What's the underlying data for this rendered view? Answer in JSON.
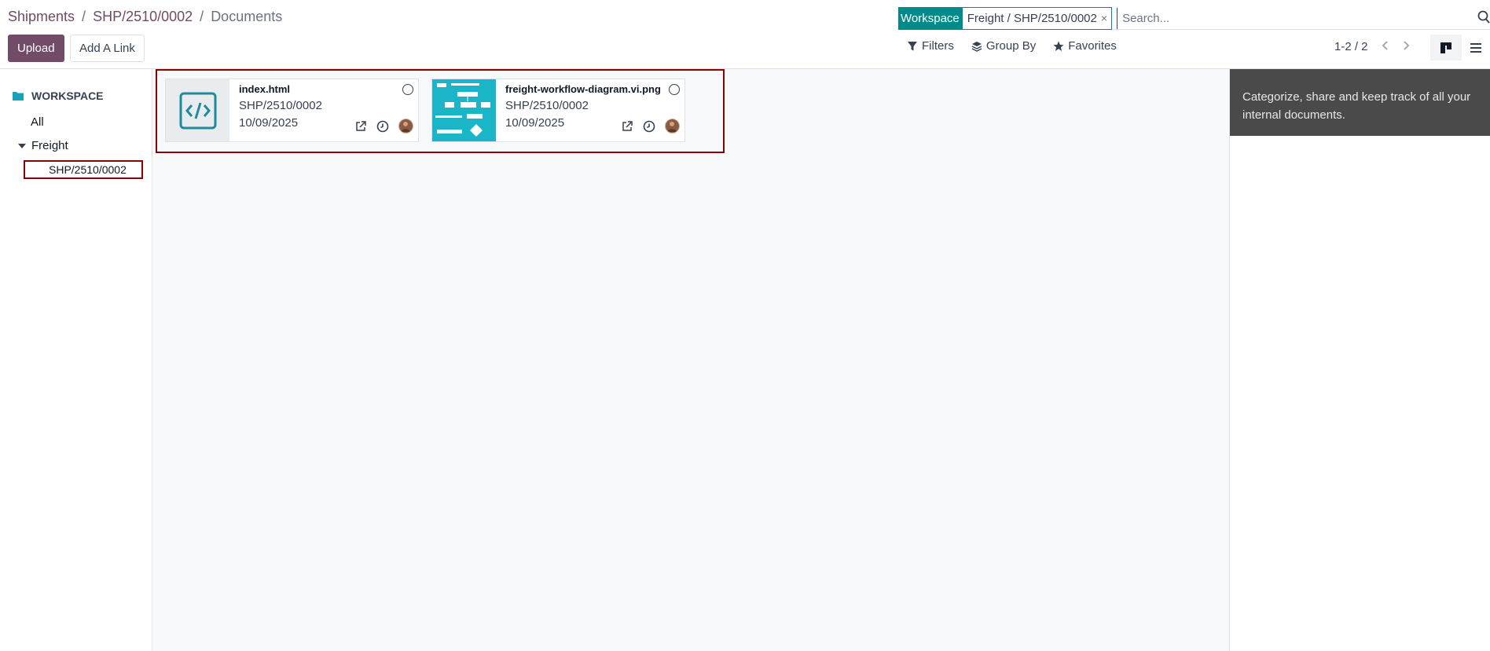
{
  "breadcrumb": {
    "items": [
      "Shipments",
      "SHP/2510/0002"
    ],
    "current": "Documents"
  },
  "toolbar": {
    "upload_label": "Upload",
    "add_link_label": "Add A Link"
  },
  "search": {
    "facet_label": "Workspace",
    "facet_value": "Freight / SHP/2510/0002",
    "facet_close": "×",
    "placeholder": "Search..."
  },
  "filters": {
    "filters_label": "Filters",
    "group_by_label": "Group By",
    "favorites_label": "Favorites"
  },
  "pager": {
    "value": "1-2 / 2"
  },
  "sidebar": {
    "workspace_title": "WORKSPACE",
    "all_label": "All",
    "freight_label": "Freight",
    "selected_label": "SHP/2510/0002"
  },
  "documents": [
    {
      "name": "index.html",
      "record": "SHP/2510/0002",
      "date": "10/09/2025",
      "thumb": "code-icon"
    },
    {
      "name": "freight-workflow-diagram.vi.png",
      "record": "SHP/2510/0002",
      "date": "10/09/2025",
      "thumb": "diagram-thumbnail"
    }
  ],
  "help": {
    "text": "Categorize, share and keep track of all your internal documents."
  },
  "colors": {
    "brand": "#714b67",
    "facet": "#018a8a",
    "highlight": "#8b0000",
    "thumb_teal": "#1ab6c8"
  }
}
